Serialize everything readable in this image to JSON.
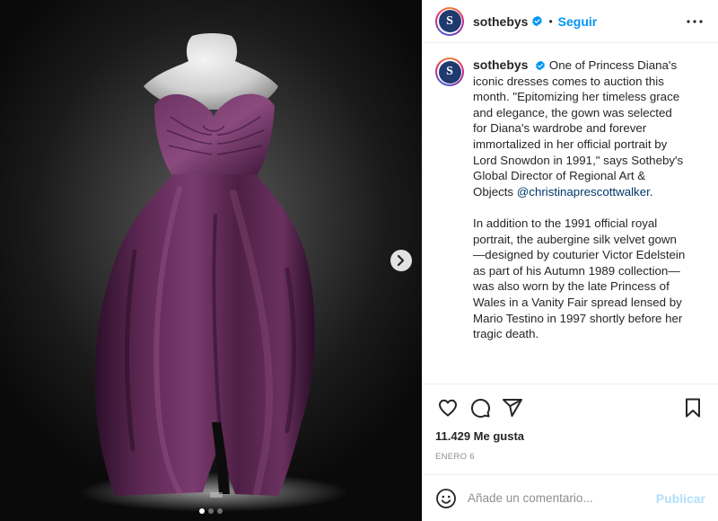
{
  "post": {
    "username": "sothebys",
    "follow_label": "Seguir",
    "separator": "•",
    "avatar_letter": "S",
    "caption_paragraph_1": "One of Princess Diana's iconic dresses comes to auction this month. \"Epitomizing her timeless grace and elegance, the gown was selected for Diana's wardrobe and forever immortalized in her official portrait by Lord Snowdon in 1991,\" says Sotheby's Global Director of Regional Art & Objects",
    "caption_mention": "@christinaprescottwalker.",
    "caption_paragraph_2": "In addition to the 1991 official royal portrait, the aubergine silk velvet gown—designed by couturier Victor Edelstein as part of his Autumn 1989 collection—was also worn by the late Princess of Wales in a Vanity Fair spread lensed by Mario Testino in 1997 shortly before her tragic death.",
    "likes_text": "11.429 Me gusta",
    "date_text": "ENERO 6"
  },
  "comment": {
    "placeholder": "Añade un comentario...",
    "publish_label": "Publicar"
  },
  "carousel": {
    "total": 3,
    "active_index": 0
  },
  "icons": {
    "verified": "verified-badge-icon",
    "more": "more-options-icon",
    "like": "heart-icon",
    "comment": "comment-bubble-icon",
    "share": "paper-plane-icon",
    "save": "bookmark-icon",
    "emoji": "emoji-icon",
    "next": "chevron-right-icon"
  },
  "colors": {
    "link": "#0095f6",
    "mention": "#00376b",
    "publish_disabled": "#b2dffc",
    "dress": "#4e1f45",
    "avatar_core": "#1f3a6e"
  }
}
